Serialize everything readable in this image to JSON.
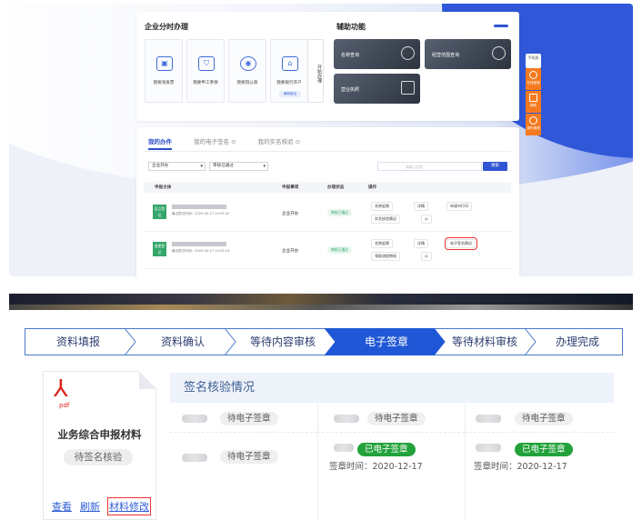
{
  "top": {
    "card1": {
      "title": "企业分时办理",
      "aux_title": "辅助功能",
      "services": [
        {
          "label": "我要领发票",
          "icon": "invoice-icon",
          "glyph": "▣"
        },
        {
          "label": "我要申工参保",
          "icon": "shield-icon",
          "glyph": "⛉"
        },
        {
          "label": "我要刻公章",
          "icon": "seal-icon",
          "glyph": "◉"
        },
        {
          "label": "我要银行开户",
          "icon": "bank-icon",
          "glyph": "⌂",
          "tag": "最新推出"
        }
      ],
      "start_label": "开始办理",
      "aux": [
        {
          "label": "名称查询"
        },
        {
          "label": "经营范围查询"
        },
        {
          "label": "营业执照"
        }
      ]
    },
    "card2": {
      "tabs": [
        "我的办件",
        "我的电子签名 ⊙",
        "我的实名核验 ⊙"
      ],
      "filter1": "企业开办",
      "filter2": "审核已通过",
      "search_placeholder": "请输入名称",
      "search_btn": "搜索",
      "headers": [
        "申报主体",
        "申报事项",
        "办理状态",
        "操作"
      ],
      "rows": [
        {
          "badge": "设立登记",
          "date": "最近提交时间：2020-04-17 15:25:20",
          "item": "企业开办",
          "status": "审核已通过",
          "ops": [
            "名称延期",
            "详情",
            "申请书打印",
            "实名核验情况",
            "◎"
          ]
        },
        {
          "badge": "变更登记",
          "date": "最近提交时间：2020-04-17 15:25:23",
          "item": "企业开办",
          "status": "审核已通过",
          "ops": [
            "名称延期",
            "详情",
            "电子签名情况",
            "领取流程审核",
            "◎"
          ]
        }
      ]
    },
    "side": {
      "top": "手机版",
      "items": [
        "在线客服",
        "帮助",
        "操作视频"
      ]
    }
  },
  "steps": [
    "资料填报",
    "资料确认",
    "等待内容审核",
    "电子签章",
    "等待材料审核",
    "办理完成"
  ],
  "active_step": 3,
  "left_card": {
    "pdf": "pdf",
    "title": "业务综合申报材料",
    "status": "待签名核验",
    "links": [
      "查看",
      "刷新",
      "材料修改"
    ]
  },
  "panel": {
    "title": "签名核验情况",
    "pending": "待电子签章",
    "done": "已电子签章",
    "date": "签章时间：2020-12-17"
  },
  "colors": {
    "accent": "#2f55d4",
    "step_active": "#1f57d6",
    "success": "#22a23a",
    "warn": "#e33333"
  }
}
